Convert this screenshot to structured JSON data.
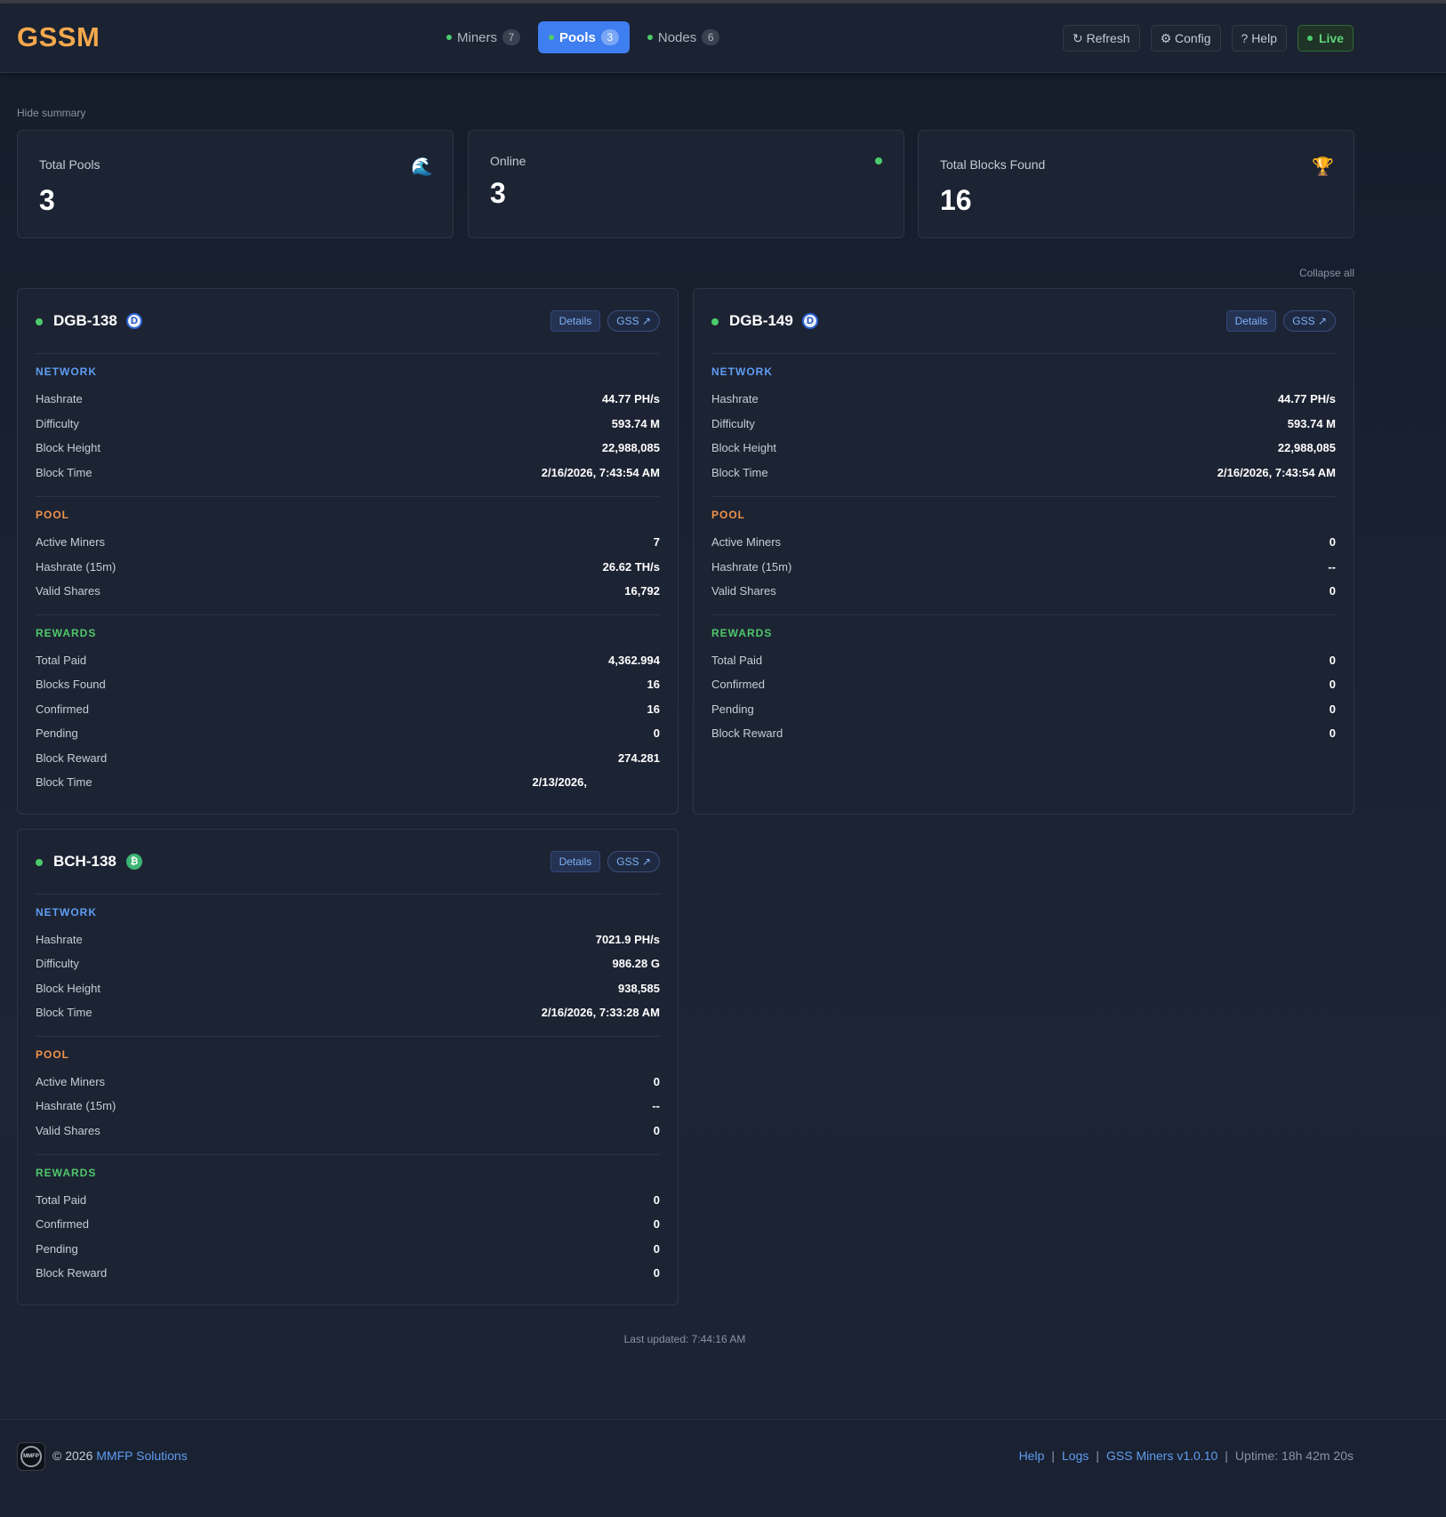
{
  "app": {
    "logo": "GSSM"
  },
  "nav": {
    "tabs": [
      {
        "label": "Miners",
        "count": "7",
        "active": false
      },
      {
        "label": "Pools",
        "count": "3",
        "active": true
      },
      {
        "label": "Nodes",
        "count": "6",
        "active": false
      }
    ]
  },
  "actions": {
    "refresh": "↻ Refresh",
    "config": "⚙ Config",
    "help": "? Help",
    "live": "Live"
  },
  "summary": {
    "toggle_label": "Hide summary",
    "cards": [
      {
        "label": "Total Pools",
        "value": "3",
        "icon": "wave-icon"
      },
      {
        "label": "Online",
        "value": "3",
        "icon": "status-dot-icon"
      },
      {
        "label": "Total Blocks Found",
        "value": "16",
        "icon": "trophy-icon"
      }
    ]
  },
  "collapse_all": "Collapse all",
  "buttons": {
    "details": "Details",
    "gss": "GSS ↗"
  },
  "sections": {
    "network": "NETWORK",
    "pool": "POOL",
    "rewards": "REWARDS"
  },
  "pools": [
    {
      "name": "DGB-138",
      "coin": "DGB",
      "network": [
        {
          "k": "Hashrate",
          "v": "44.77 PH/s"
        },
        {
          "k": "Difficulty",
          "v": "593.74 M"
        },
        {
          "k": "Block Height",
          "v": "22,988,085"
        },
        {
          "k": "Block Time",
          "v": "2/16/2026, 7:43:54 AM"
        }
      ],
      "pool": [
        {
          "k": "Active Miners",
          "v": "7"
        },
        {
          "k": "Hashrate (15m)",
          "v": "26.62 TH/s"
        },
        {
          "k": "Valid Shares",
          "v": "16,792"
        }
      ],
      "rewards": [
        {
          "k": "Total Paid",
          "v": "4,362.994"
        },
        {
          "k": "Blocks Found",
          "v": "16"
        },
        {
          "k": "Confirmed",
          "v": "16"
        },
        {
          "k": "Pending",
          "v": "0"
        },
        {
          "k": "Block Reward",
          "v": "274.281"
        },
        {
          "k": "Block Time",
          "v": "2/13/2026,"
        }
      ]
    },
    {
      "name": "DGB-149",
      "coin": "DGB",
      "network": [
        {
          "k": "Hashrate",
          "v": "44.77 PH/s"
        },
        {
          "k": "Difficulty",
          "v": "593.74 M"
        },
        {
          "k": "Block Height",
          "v": "22,988,085"
        },
        {
          "k": "Block Time",
          "v": "2/16/2026, 7:43:54 AM"
        }
      ],
      "pool": [
        {
          "k": "Active Miners",
          "v": "0"
        },
        {
          "k": "Hashrate (15m)",
          "v": "--"
        },
        {
          "k": "Valid Shares",
          "v": "0"
        }
      ],
      "rewards": [
        {
          "k": "Total Paid",
          "v": "0"
        },
        {
          "k": "Confirmed",
          "v": "0"
        },
        {
          "k": "Pending",
          "v": "0"
        },
        {
          "k": "Block Reward",
          "v": "0"
        }
      ]
    },
    {
      "name": "BCH-138",
      "coin": "BCH",
      "network": [
        {
          "k": "Hashrate",
          "v": "7021.9 PH/s"
        },
        {
          "k": "Difficulty",
          "v": "986.28 G"
        },
        {
          "k": "Block Height",
          "v": "938,585"
        },
        {
          "k": "Block Time",
          "v": "2/16/2026, 7:33:28 AM"
        }
      ],
      "pool": [
        {
          "k": "Active Miners",
          "v": "0"
        },
        {
          "k": "Hashrate (15m)",
          "v": "--"
        },
        {
          "k": "Valid Shares",
          "v": "0"
        }
      ],
      "rewards": [
        {
          "k": "Total Paid",
          "v": "0"
        },
        {
          "k": "Confirmed",
          "v": "0"
        },
        {
          "k": "Pending",
          "v": "0"
        },
        {
          "k": "Block Reward",
          "v": "0"
        }
      ]
    }
  ],
  "last_updated": "Last updated: 7:44:16 AM",
  "footer": {
    "logo_text": "MMFP",
    "copyright": "© 2026",
    "company": "MMFP Solutions",
    "links": [
      "Help",
      "Logs",
      "GSS Miners v1.0.10"
    ],
    "separator": "|",
    "uptime": "Uptime: 18h 42m 20s"
  },
  "colors": {
    "accent": "#3f7ef0",
    "logo": "#f5a84d",
    "online": "#4ccb6b",
    "network_title": "#5f9df2",
    "pool_title": "#f0934a",
    "rewards_title": "#4fc86a"
  }
}
